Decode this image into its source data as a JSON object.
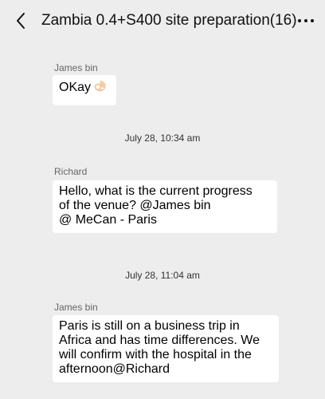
{
  "header": {
    "title": "Zambia 0.4+S400 site preparation(16)",
    "back_icon": "chevron-left-icon",
    "more_icon": "more-horizontal-icon"
  },
  "messages": [
    {
      "sender": "James bin",
      "text": "OKay",
      "emoji": "ok-hand-icon"
    },
    {
      "timestamp": "July 28, 10:34 am"
    },
    {
      "sender": "Richard",
      "text": "Hello, what is the current progress\nof the venue? @James bin\n@ MeCan - Paris"
    },
    {
      "timestamp": "July 28, 11:04 am"
    },
    {
      "sender": "James bin",
      "text": "Paris is still on a business trip in\nAfrica and has time differences. We\nwill confirm with the hospital in the\nafternoon@Richard"
    }
  ]
}
